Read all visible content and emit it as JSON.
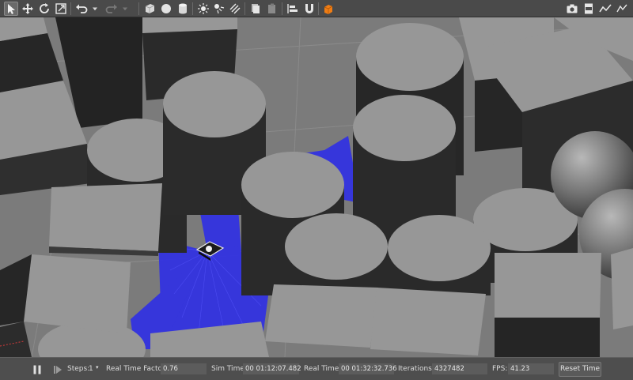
{
  "toolbar": {
    "tools": [
      "select-mode",
      "translate-mode",
      "rotate-mode",
      "scale-mode",
      "undo",
      "undo-history",
      "redo",
      "redo-history",
      "box-shape",
      "sphere-shape",
      "cylinder-shape",
      "point-light",
      "spot-light",
      "directional-light",
      "copy",
      "paste",
      "align",
      "snap",
      "change-view"
    ],
    "right_tools": [
      "screenshot",
      "log-data",
      "plot"
    ]
  },
  "status": {
    "steps_label": "Steps:",
    "steps_value": "1",
    "rtf_label": "Real Time Factor:",
    "rtf_value": "0.76",
    "sim_time_label": "Sim Time:",
    "sim_time_value": "00 01:12:07.482",
    "real_time_label": "Real Time:",
    "real_time_value": "00 01:32:32.736",
    "iterations_label": "Iterations:",
    "iterations_value": "4327482",
    "fps_label": "FPS:",
    "fps_value": "41.23",
    "reset_label": "Reset Time"
  },
  "colors": {
    "toolbar_bg": "#4a4a4a",
    "scene_ground": "#7b7b7b",
    "object_top": "#9a9a9a",
    "object_side": "#2b2b2b",
    "laser_scan": "#2f2fe6",
    "selection_accent": "#f07d14"
  }
}
